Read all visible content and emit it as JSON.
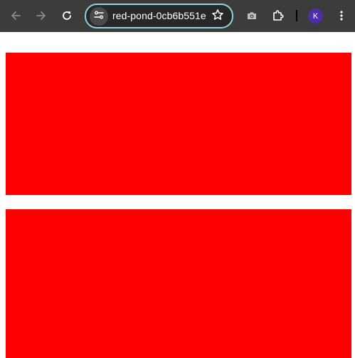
{
  "browser": {
    "url": "red-pond-0cb6b551e",
    "profile_initial": "K",
    "icons": {
      "back": "arrow-left-icon",
      "forward": "arrow-right-icon",
      "reload": "reload-icon",
      "site_info": "tune-icon",
      "bookmark": "star-icon",
      "screenshot": "camera-icon",
      "extensions": "puzzle-icon",
      "menu": "kebab-menu-icon"
    },
    "colors": {
      "toolbar": "#3c3c3c",
      "omnibox_border": "#8fd3e0",
      "avatar": "#4c2fa8"
    }
  },
  "page": {
    "blocks": [
      {
        "color": "#ff0000"
      },
      {
        "color": "#ff0000"
      }
    ]
  }
}
